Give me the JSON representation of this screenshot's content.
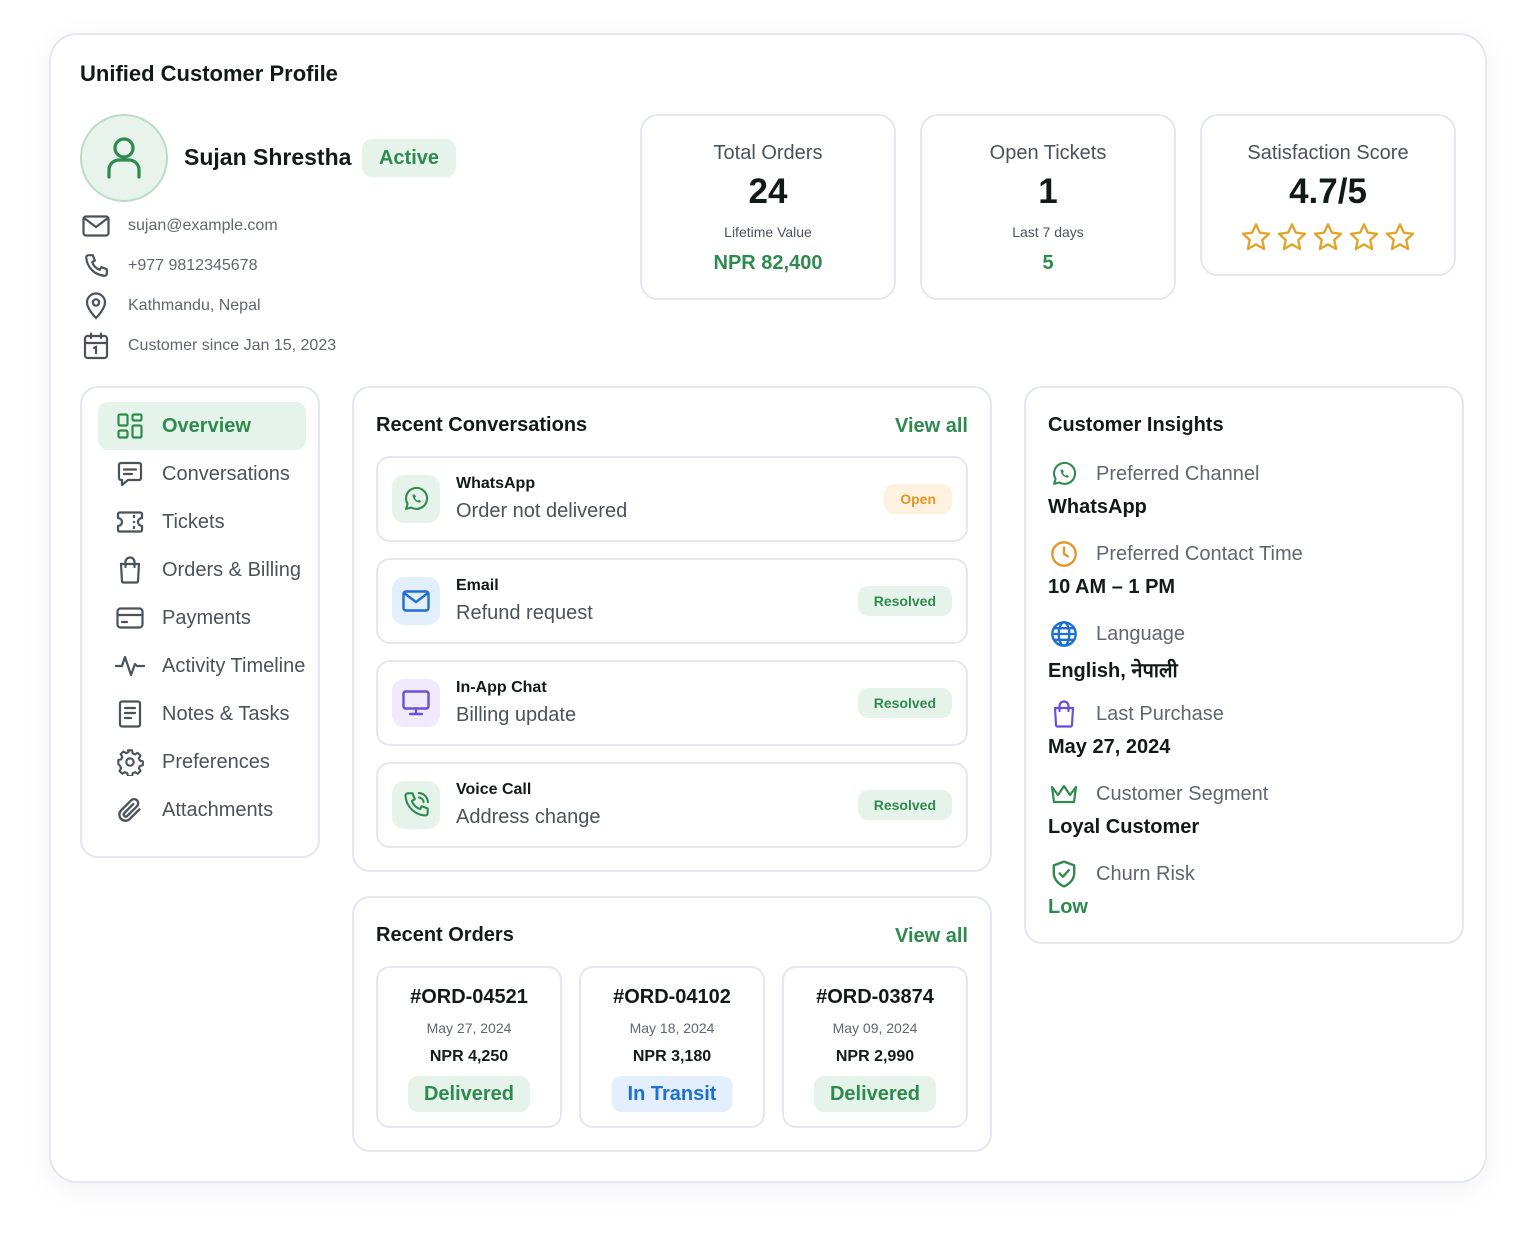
{
  "page": {
    "title": "Unified Customer Profile"
  },
  "colors": {
    "accent": "#2e8a4e",
    "accent_bg": "#e6f3ea",
    "star": "#e0a52a",
    "open": "#e0962a",
    "transit": "#1d6fd1"
  },
  "customer": {
    "name": "Sujan Shrestha",
    "status": "Active",
    "email": "sujan@example.com",
    "phone": "+977 9812345678",
    "location": "Kathmandu, Nepal",
    "since": "Customer since Jan 15, 2023"
  },
  "stats": {
    "orders": {
      "label": "Total Orders",
      "value": "24",
      "sub_label": "Lifetime Value",
      "sub_value": "NPR 82,400"
    },
    "tickets": {
      "label": "Open Tickets",
      "value": "1",
      "sub_label": "Last 7 days",
      "sub_value": "5"
    },
    "satisfaction": {
      "label": "Satisfaction Score",
      "value": "4.7/5",
      "stars_shown": 5,
      "star_icon": "star-outline-icon"
    }
  },
  "sidebar": {
    "items": [
      {
        "label": "Overview",
        "icon": "grid-icon",
        "active": true
      },
      {
        "label": "Conversations",
        "icon": "chat-icon"
      },
      {
        "label": "Tickets",
        "icon": "ticket-icon"
      },
      {
        "label": "Orders & Billing",
        "icon": "bag-icon"
      },
      {
        "label": "Payments",
        "icon": "card-icon"
      },
      {
        "label": "Activity Timeline",
        "icon": "activity-icon"
      },
      {
        "label": "Notes & Tasks",
        "icon": "notes-icon"
      },
      {
        "label": "Preferences",
        "icon": "gear-icon"
      },
      {
        "label": "Attachments",
        "icon": "paperclip-icon"
      }
    ]
  },
  "conversations": {
    "title": "Recent Conversations",
    "view_all": "View all",
    "items": [
      {
        "channel": "WhatsApp",
        "message": "Order not delivered",
        "status": "Open",
        "icon": "whatsapp-icon"
      },
      {
        "channel": "Email",
        "message": "Refund request",
        "status": "Resolved",
        "icon": "mail-icon"
      },
      {
        "channel": "In-App Chat",
        "message": "Billing update",
        "status": "Resolved",
        "icon": "monitor-icon"
      },
      {
        "channel": "Voice Call",
        "message": "Address change",
        "status": "Resolved",
        "icon": "phone-call-icon"
      }
    ]
  },
  "orders": {
    "title": "Recent Orders",
    "view_all": "View all",
    "items": [
      {
        "id": "#ORD-04521",
        "date": "May 27, 2024",
        "amount": "NPR 4,250",
        "status": "Delivered"
      },
      {
        "id": "#ORD-04102",
        "date": "May 18, 2024",
        "amount": "NPR 3,180",
        "status": "In Transit"
      },
      {
        "id": "#ORD-03874",
        "date": "May 09, 2024",
        "amount": "NPR 2,990",
        "status": "Delivered"
      }
    ]
  },
  "insights": {
    "title": "Customer Insights",
    "items": [
      {
        "label": "Preferred Channel",
        "value": "WhatsApp",
        "icon": "whatsapp-icon"
      },
      {
        "label": "Preferred Contact Time",
        "value": "10 AM – 1 PM",
        "icon": "clock-icon"
      },
      {
        "label": "Language",
        "value": "English, नेपाली",
        "icon": "globe-icon"
      },
      {
        "label": "Last Purchase",
        "value": "May 27, 2024",
        "icon": "bag-icon"
      },
      {
        "label": "Customer Segment",
        "value": "Loyal Customer",
        "icon": "crown-icon"
      },
      {
        "label": "Churn Risk",
        "value": "Low",
        "icon": "shield-check-icon"
      }
    ]
  }
}
